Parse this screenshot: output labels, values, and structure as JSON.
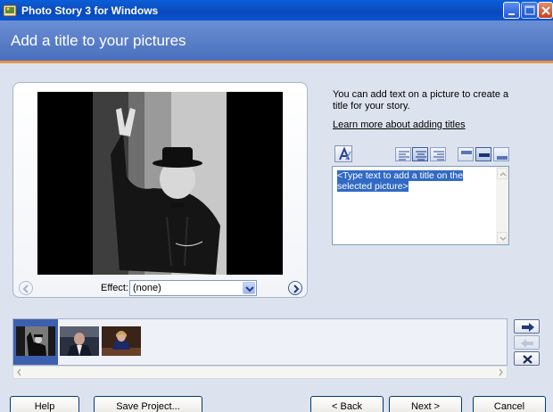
{
  "window": {
    "title": "Photo Story 3 for Windows",
    "icon": "photo-story-app-icon"
  },
  "header": {
    "title": "Add a title to your pictures"
  },
  "preview": {
    "effect_label": "Effect:",
    "effect_value": "(none)",
    "prev_icon": "chevron-left-icon",
    "next_icon": "chevron-right-icon"
  },
  "right": {
    "intro": "You can add text on a picture to create a title for your story.",
    "learn_link": "Learn more about adding titles",
    "title_text_placeholder": "<Type text to add a title on the selected picture>"
  },
  "formatting": {
    "font_icon": "font-a-icon",
    "horizontal_align": [
      "align-left-icon",
      "align-center-icon",
      "align-right-icon"
    ],
    "vertical_align": [
      "align-top-icon",
      "align-middle-icon",
      "align-bottom-icon"
    ]
  },
  "filmstrip": {
    "thumbnails": [
      "portrait-victory-sign",
      "portrait-suit-man",
      "portrait-woman-desk"
    ],
    "selected_index": 0,
    "side_buttons": [
      "move-right-arrow-icon",
      "move-left-arrow-icon",
      "delete-x-icon"
    ]
  },
  "buttons": {
    "help": "Help",
    "save_project": "Save Project...",
    "back": "< Back",
    "next": "Next >",
    "cancel": "Cancel"
  },
  "colors": {
    "titlebar": "#0a5fd8",
    "header": "#5a7fc8",
    "header_accent": "#e8944a",
    "selection": "#316ac5"
  }
}
